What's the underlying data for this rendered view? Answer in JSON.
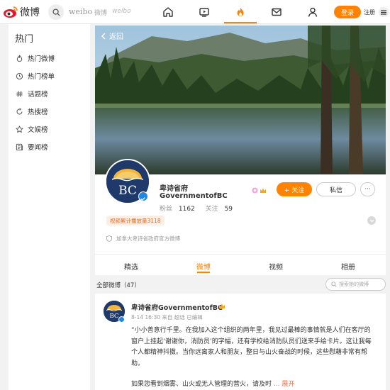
{
  "topbar": {
    "logo_text": "微博",
    "brand_en": "weibo",
    "brand_cn": "微博",
    "brand_script": "weibo",
    "login_label": "登录",
    "register_label": "注册",
    "accent_color": "#ff8200"
  },
  "sidebar": {
    "title": "热门",
    "items": [
      {
        "label": "热门微博",
        "icon": "flame-outline-icon"
      },
      {
        "label": "热门榜单",
        "icon": "clock-icon"
      },
      {
        "label": "话题榜",
        "icon": "hashtag-icon"
      },
      {
        "label": "热搜榜",
        "icon": "circle-refresh-icon"
      },
      {
        "label": "文娱榜",
        "icon": "star-icon"
      },
      {
        "label": "要闻榜",
        "icon": "news-icon"
      }
    ]
  },
  "profile": {
    "back_label": "返回",
    "name_cn": "卑诗省府",
    "name_en": "GovernmentofBC",
    "avatar_text": "BC",
    "fans_label": "粉丝",
    "fans_value": "1162",
    "following_label": "关注",
    "following_value": "59",
    "follow_label": "+ 关注",
    "message_label": "私信",
    "more_label": "···",
    "video_badge": "视频累计播放量3118",
    "bio": "加拿大卑诗省政府官方微博"
  },
  "tabs": [
    "精选",
    "微博",
    "视频",
    "相册"
  ],
  "active_tab": "微博",
  "feed": {
    "count_label": "全部微博（47）",
    "search_placeholder": "搜索她的微博"
  },
  "post": {
    "author": "卑诗省府GovernmentofBC",
    "meta": "8-14 16:30 来自 超话 已编辑",
    "text": "“小小善意行千里。在我加入这个组织的两年里，我见过最棒的事情就是人们在客厅的窗户上挂起‘谢谢你，消防员’的字幅，还有学校给消防队员们送来手绘卡片。这让我每个人都精神抖擞。当你远离家人和朋友，整日与山火奋战的时候，这些慰藉非常有帮助。",
    "text2": "如果您看到烟雾、山火或无人管理的营火，请及时",
    "expand_label": "... 展开"
  }
}
